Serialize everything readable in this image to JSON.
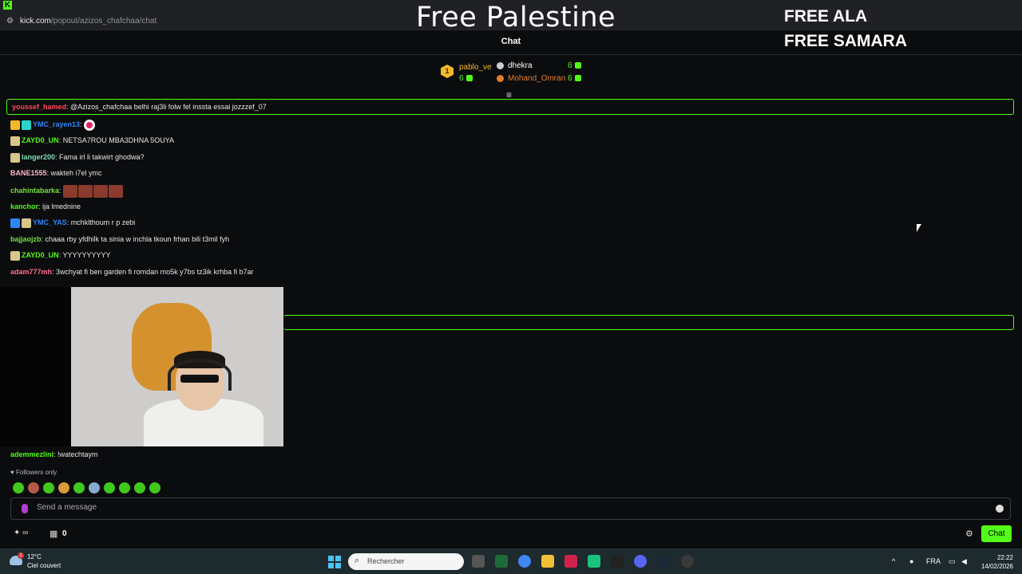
{
  "browser": {
    "url_host": "kick.com",
    "url_path": "/popout/azizos_chafchaa/chat"
  },
  "overlay": {
    "title": "Free Palestine",
    "line1": "FREE ALA",
    "line2": "FREE SAMARA"
  },
  "chat": {
    "header": "Chat",
    "leaderboard": [
      {
        "name": "pablo_ve",
        "count": "6",
        "rank": "1"
      },
      {
        "name": "dhekra",
        "count": "6"
      },
      {
        "name": "Mohand_Omran",
        "count": "6"
      }
    ],
    "pinned": {
      "user": "youssef_hamed",
      "text": ": @Azizos_chafchaa belhi raj3li folw fel inssta essai jozzzef_07"
    },
    "messages": [
      {
        "user": "YMC_rayen13",
        "text": ": ",
        "color": "#2e86ff"
      },
      {
        "user": "ZAYD0_UN",
        "text": ": NETSA7ROU MBA3DHNA 5OUYA",
        "color": "#53fc18"
      },
      {
        "user": "langer200",
        "text": ": Fama irl li takwirt ghodwa?",
        "color": "#7ee0b4"
      },
      {
        "user": "BANE1555",
        "text": ": wakteh i7el ymc",
        "color": "#ffb7c8"
      },
      {
        "user": "chahintabarka",
        "text": ": ",
        "color": "#75e03a"
      },
      {
        "user": "kanchor",
        "text": ": ija lmednine",
        "color": "#53fc18"
      },
      {
        "user": "YMC_YAS",
        "text": ": mchklthoum r p zebi",
        "color": "#2e86ff"
      },
      {
        "user": "bajjaojzb",
        "text": ": chaaa rby yfdhilk ta sinia w inchla tkoun frhan bili t3mil fyh",
        "color": "#75e03a"
      },
      {
        "user": "ZAYD0_UN",
        "text": ": YYYYYYYYYY",
        "color": "#53fc18"
      },
      {
        "user": "adam777mh",
        "text": ": 3wchyat fi ben garden fi romdan mo5k y7bs tz3ik krhba fi b7ar",
        "color": "#ff6e8a"
      }
    ],
    "last_message": {
      "user": "ademmezlini",
      "text": ": !watechtaym",
      "color": "#53fc18"
    },
    "followers_only": "Followers only",
    "input_placeholder": "Send a message",
    "gift_count": "0",
    "chat_button": "Chat"
  },
  "taskbar": {
    "temperature": "12°C",
    "weather": "Ciel couvert",
    "weather_badge": "1",
    "search_placeholder": "Rechercher",
    "language": "FRA",
    "time": "22:22",
    "date": "14/02/2026"
  }
}
